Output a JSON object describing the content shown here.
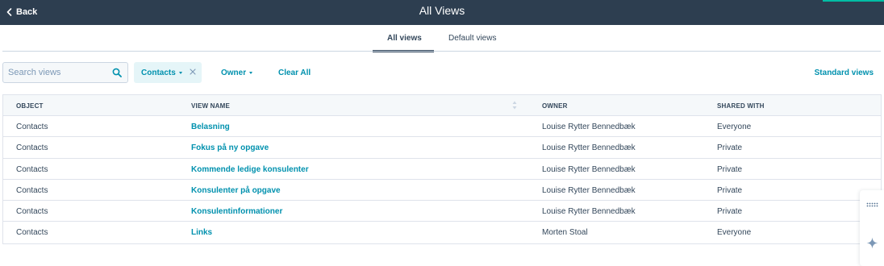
{
  "header": {
    "back_label": "Back",
    "title": "All Views",
    "accent_color": "#00bda5",
    "background_color": "#2d3e50"
  },
  "tabs": [
    {
      "label": "All views",
      "active": true
    },
    {
      "label": "Default views",
      "active": false
    }
  ],
  "search": {
    "placeholder": "Search views",
    "value": "",
    "icon": "search-icon"
  },
  "filters": {
    "object_filter": {
      "label": "Contacts",
      "removable": true
    },
    "owner_label": "Owner",
    "clear_all_label": "Clear All"
  },
  "standard_views_label": "Standard views",
  "table": {
    "columns": [
      "OBJECT",
      "VIEW NAME",
      "OWNER",
      "SHARED WITH"
    ],
    "rows": [
      {
        "object": "Contacts",
        "view_name": "Belasning",
        "owner": "Louise Rytter Bennedbæk",
        "shared_with": "Everyone"
      },
      {
        "object": "Contacts",
        "view_name": "Fokus på ny opgave",
        "owner": "Louise Rytter Bennedbæk",
        "shared_with": "Private"
      },
      {
        "object": "Contacts",
        "view_name": "Kommende ledige konsulenter",
        "owner": "Louise Rytter Bennedbæk",
        "shared_with": "Private"
      },
      {
        "object": "Contacts",
        "view_name": "Konsulenter på opgave",
        "owner": "Louise Rytter Bennedbæk",
        "shared_with": "Private"
      },
      {
        "object": "Contacts",
        "view_name": "Konsulentinformationer",
        "owner": "Louise Rytter Bennedbæk",
        "shared_with": "Private"
      },
      {
        "object": "Contacts",
        "view_name": "Links",
        "owner": "Morten Stoal",
        "shared_with": "Everyone"
      }
    ]
  },
  "side_widget": {
    "icons": [
      "grid-dots-icon",
      "sparkle-icon"
    ]
  },
  "colors": {
    "link": "#0091ae",
    "text": "#33475b",
    "chip_bg": "#e5f5f8",
    "header_bg": "#f5f8fa"
  }
}
